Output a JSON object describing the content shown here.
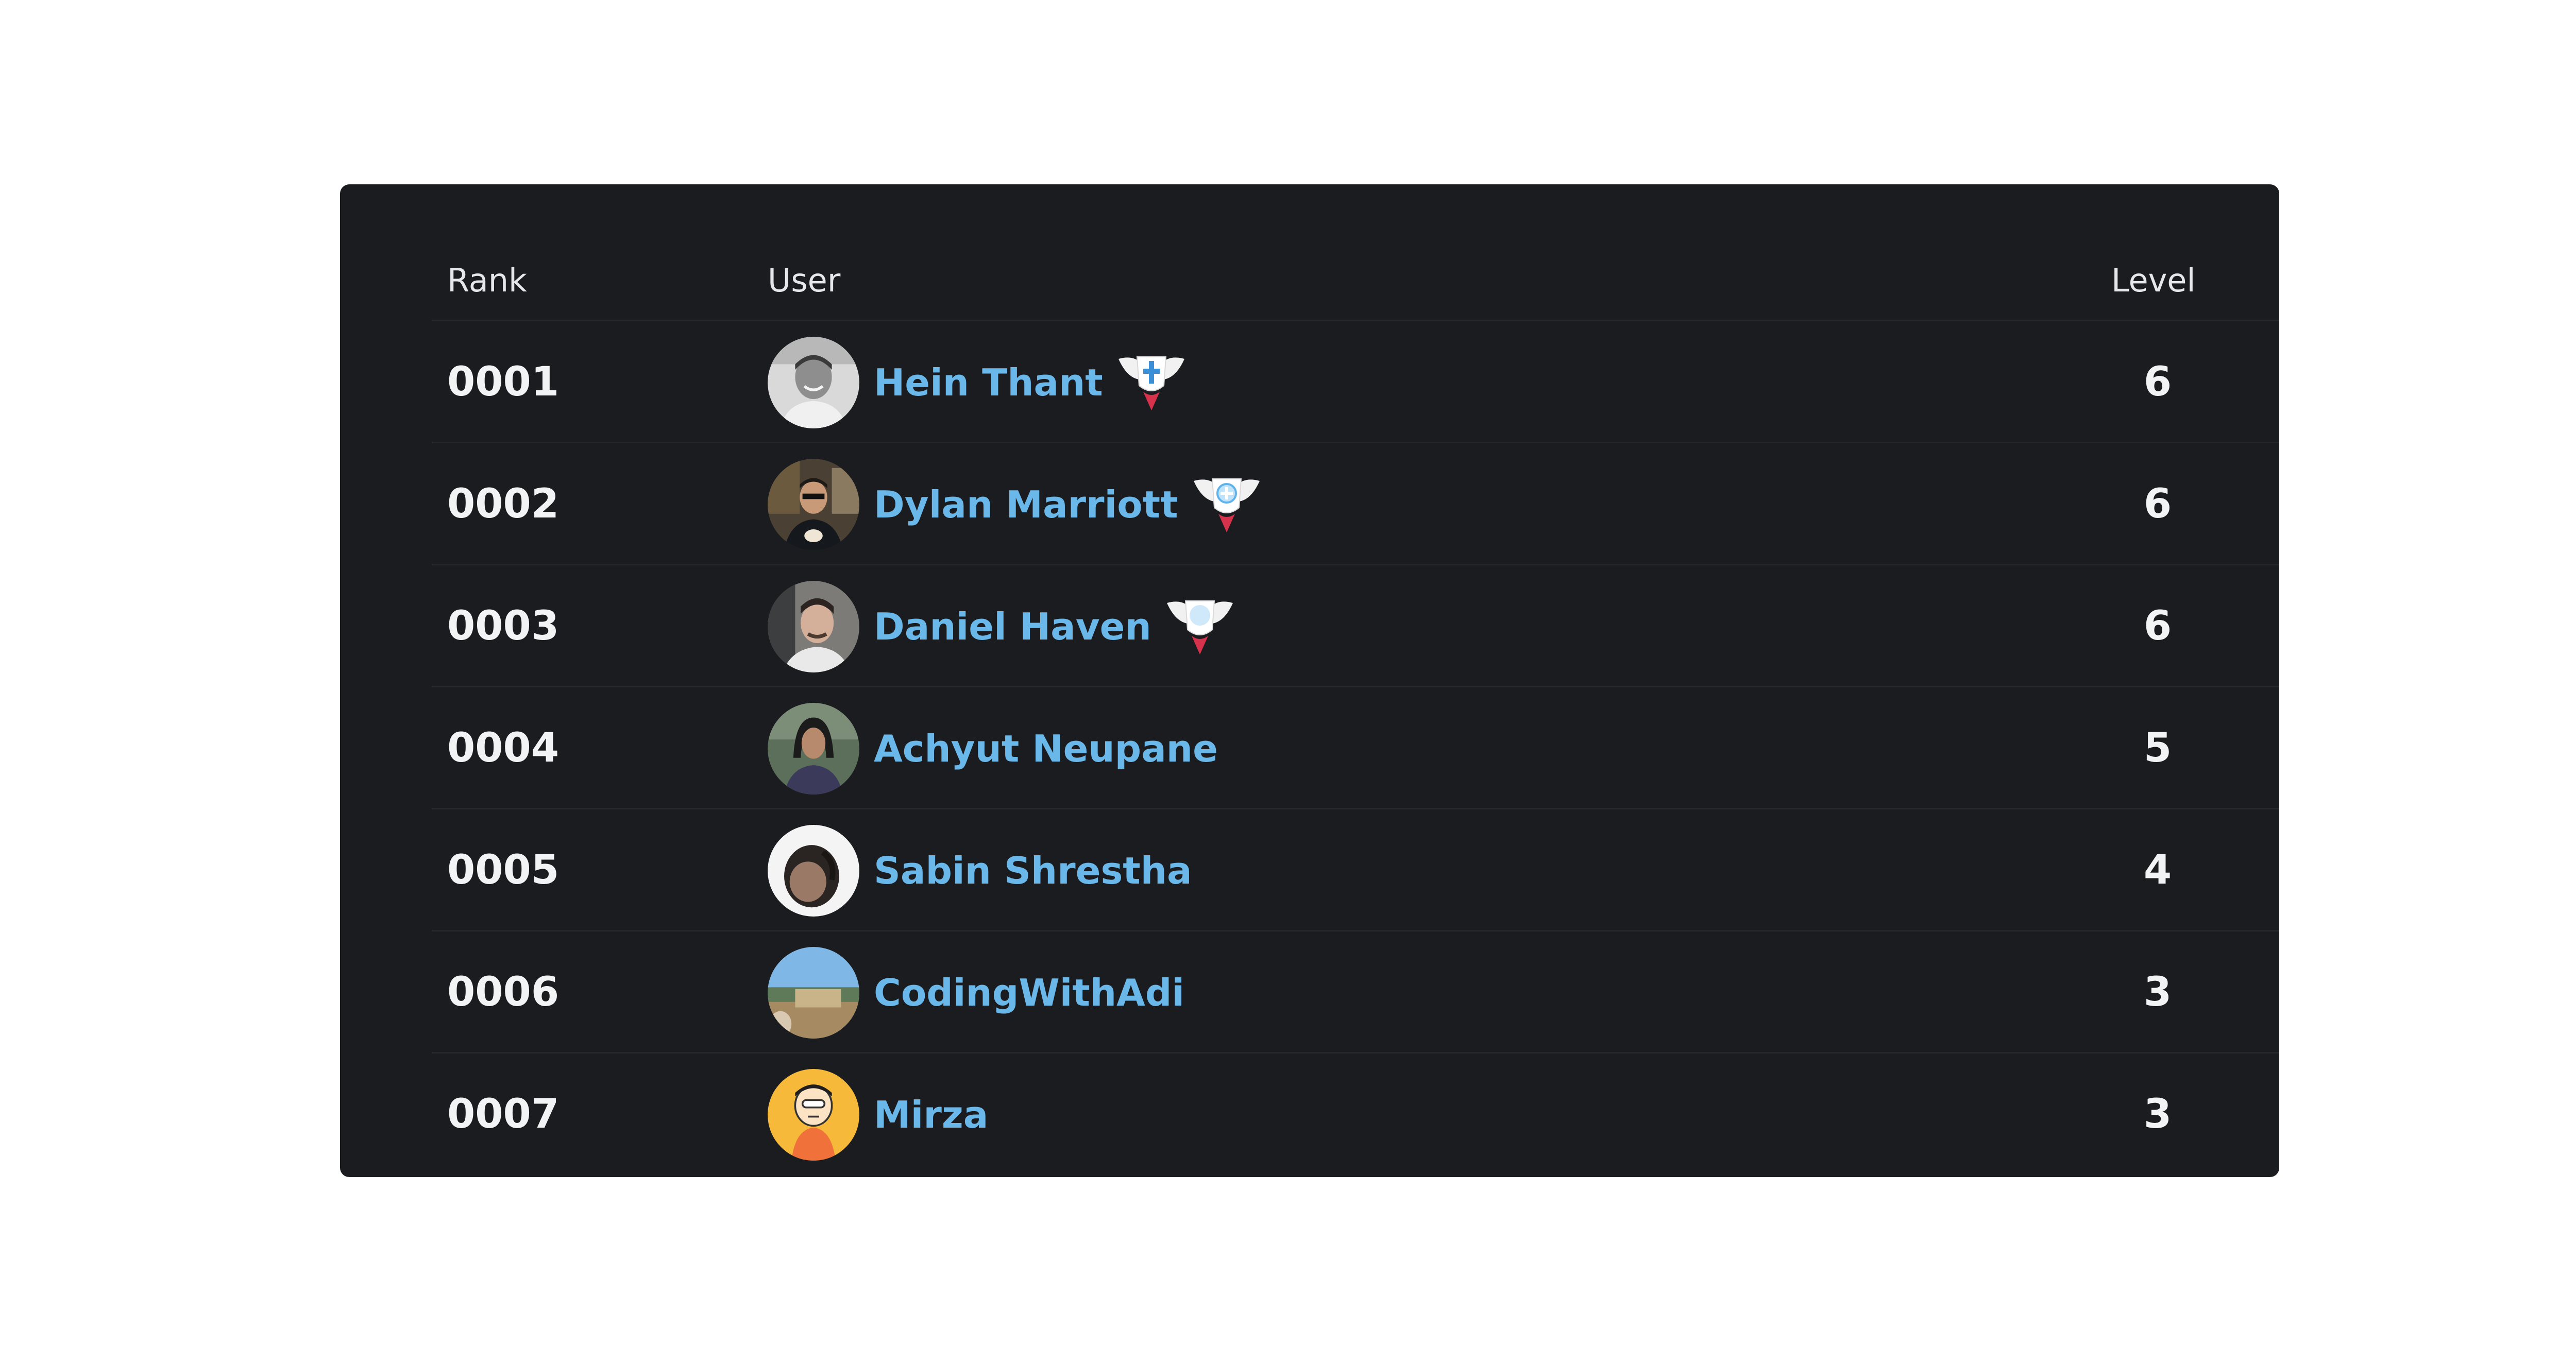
{
  "leaderboard": {
    "columns": {
      "rank": "Rank",
      "user": "User",
      "level": "Level"
    },
    "rows": [
      {
        "rank": "0001",
        "name": "Hein Thant",
        "level": "6",
        "badge": "winged-shield-cross-icon",
        "avatar": "grayscale-portrait"
      },
      {
        "rank": "0002",
        "name": "Dylan Marriott",
        "level": "6",
        "badge": "winged-shield-plus-icon",
        "avatar": "dark-photo-portrait"
      },
      {
        "rank": "0003",
        "name": "Daniel Haven",
        "level": "6",
        "badge": "winged-shield-circle-icon",
        "avatar": "photo-portrait"
      },
      {
        "rank": "0004",
        "name": "Achyut Neupane",
        "level": "5",
        "badge": null,
        "avatar": "photo-portrait"
      },
      {
        "rank": "0005",
        "name": "Sabin Shrestha",
        "level": "4",
        "badge": null,
        "avatar": "photo-portrait"
      },
      {
        "rank": "0006",
        "name": "CodingWithAdi",
        "level": "3",
        "badge": null,
        "avatar": "landscape-photo"
      },
      {
        "rank": "0007",
        "name": "Mirza",
        "level": "3",
        "badge": null,
        "avatar": "cartoon-character"
      }
    ]
  },
  "colors": {
    "card_bg": "#1b1c1f",
    "name_link": "#6ab7ea",
    "text": "#f2f3f5",
    "divider": "#26272b",
    "page_bg": "#ffffff"
  }
}
